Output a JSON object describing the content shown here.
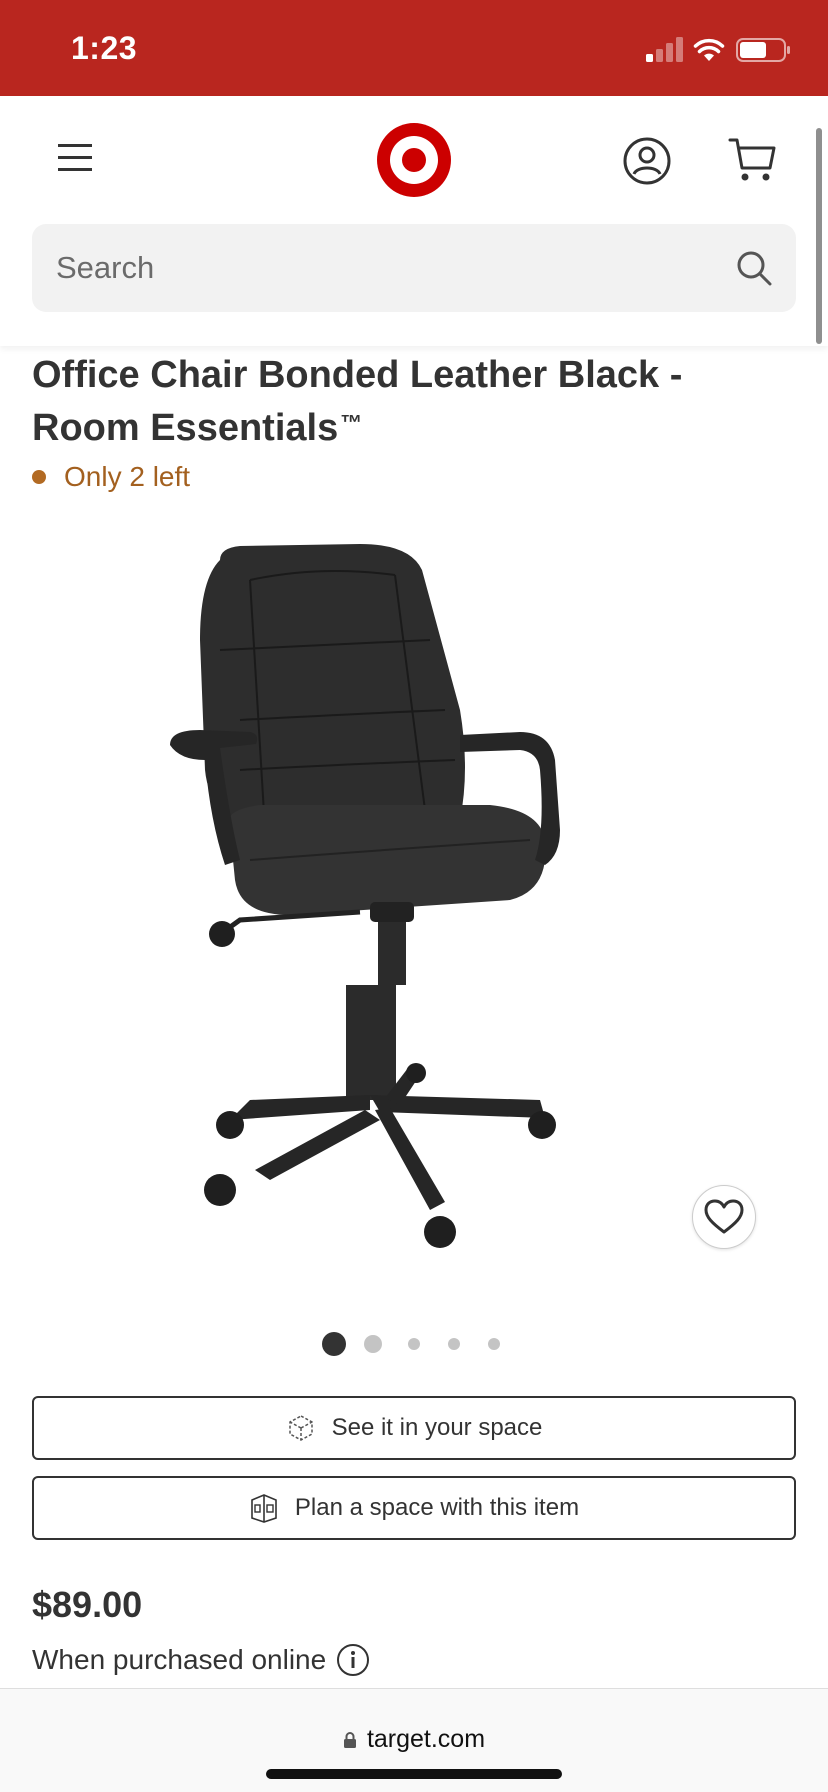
{
  "status_bar": {
    "time": "1:23",
    "background_color": "#b9261f",
    "icons": [
      "signal-icon",
      "wifi-icon",
      "battery-icon"
    ]
  },
  "header": {
    "menu_icon": "hamburger-menu-icon",
    "logo": "target-bullseye-logo",
    "account_icon": "account-icon",
    "cart_icon": "cart-icon",
    "brand_color": "#cc0000"
  },
  "search": {
    "placeholder": "Search",
    "value": "",
    "icon": "search-icon"
  },
  "product": {
    "title": "Office Chair Bonded Leather Black - Room Essentials",
    "trademark": "™",
    "stock_status": "Only 2 left",
    "stock_color": "#b26a23",
    "image_icon": "office-chair-image",
    "favorite_icon": "heart-icon",
    "carousel": {
      "total": 5,
      "active_index": 0
    }
  },
  "actions": {
    "ar_label": "See it in your space",
    "ar_icon": "ar-cube-icon",
    "plan_label": "Plan a space with this item",
    "plan_icon": "room-planner-icon"
  },
  "pricing": {
    "price": "$89.00",
    "note": "When purchased online",
    "info_icon": "info-icon"
  },
  "browser": {
    "url": "target.com",
    "lock_icon": "lock-icon"
  }
}
